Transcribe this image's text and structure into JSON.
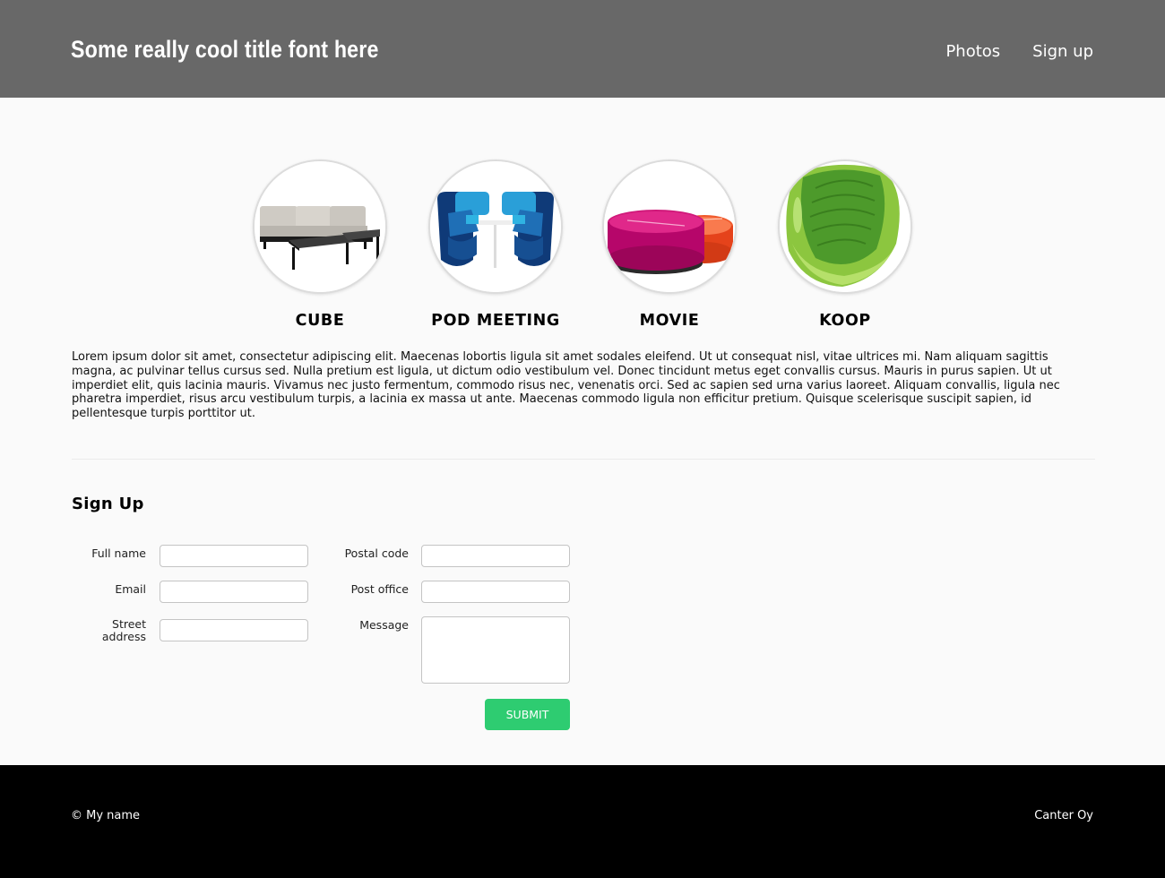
{
  "header": {
    "title": "Some really cool title font here",
    "nav": [
      {
        "label": "Photos"
      },
      {
        "label": "Sign up"
      }
    ]
  },
  "products": [
    {
      "label": "CUBE",
      "icon": "sofa-icon"
    },
    {
      "label": "POD MEETING",
      "icon": "pod-meeting-chairs-icon"
    },
    {
      "label": "MOVIE",
      "icon": "ottoman-icon"
    },
    {
      "label": "KOOP",
      "icon": "egg-chair-icon"
    }
  ],
  "intro": {
    "text": "Lorem ipsum dolor sit amet, consectetur adipiscing elit. Maecenas lobortis ligula sit amet sodales eleifend. Ut ut consequat nisl, vitae ultrices mi. Nam aliquam sagittis magna, ac pulvinar tellus cursus sed. Nulla pretium est ligula, ut dictum odio vestibulum vel. Donec tincidunt metus eget convallis cursus. Mauris in purus sapien. Ut ut imperdiet elit, quis lacinia mauris. Vivamus nec justo fermentum, commodo risus nec, venenatis orci. Sed ac sapien sed urna varius laoreet. Aliquam convallis, ligula nec pharetra imperdiet, risus arcu vestibulum turpis, a lacinia ex massa ut ante. Maecenas commodo ligula non efficitur pretium. Quisque scelerisque suscipit sapien, id pellentesque turpis porttitor ut."
  },
  "signup": {
    "title": "Sign Up",
    "fields": {
      "full_name": {
        "label": "Full name",
        "value": ""
      },
      "email": {
        "label": "Email",
        "value": ""
      },
      "street_address": {
        "label": "Street address",
        "value": ""
      },
      "postal_code": {
        "label": "Postal code",
        "value": ""
      },
      "post_office": {
        "label": "Post office",
        "value": ""
      },
      "message": {
        "label": "Message",
        "value": ""
      }
    },
    "submit_label": "SUBMIT"
  },
  "footer": {
    "left": "© My name",
    "right": "Canter Oy"
  },
  "colors": {
    "header_bg": "#686868",
    "page_bg": "#fafafa",
    "footer_bg": "#000000",
    "submit_bg": "#2ecc71"
  }
}
